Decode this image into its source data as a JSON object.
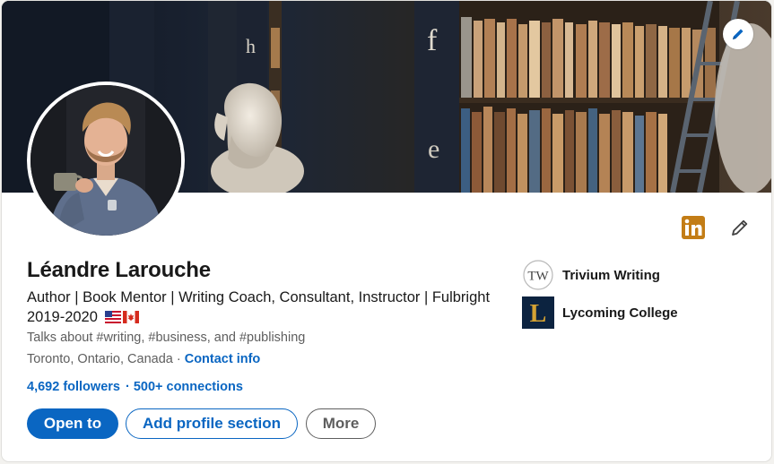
{
  "profile": {
    "name": "Léandre Larouche",
    "headline": "Author | Book Mentor | Writing Coach, Consultant, Instructor | Fulbright 2019-2020",
    "talks_about": "Talks about #writing, #business, and #publishing",
    "location": "Toronto, Ontario, Canada",
    "location_separator": " · ",
    "contact_info": "Contact info",
    "followers": "4,692 followers",
    "stats_separator": "·",
    "connections": "500+ connections"
  },
  "actions": {
    "open_to": "Open to",
    "add_section": "Add profile section",
    "more": "More"
  },
  "organizations": [
    {
      "name": "Trivium Writing",
      "logo_icon": "tw-monogram-icon",
      "logo_text": "TW"
    },
    {
      "name": "Lycoming College",
      "logo_icon": "lycoming-l-icon",
      "logo_text": "L"
    }
  ],
  "icons": {
    "banner_edit": "pencil-icon",
    "linkedin": "linkedin-icon",
    "intro_edit": "pencil-icon",
    "flags": "us-canada-flags-icon"
  },
  "colors": {
    "accent": "#0a66c2",
    "text_primary": "#191919",
    "text_secondary": "#5e5e5e",
    "linkedin_badge": "#c37d16",
    "lycoming_navy": "#0c2340",
    "lycoming_gold": "#d4a233"
  }
}
